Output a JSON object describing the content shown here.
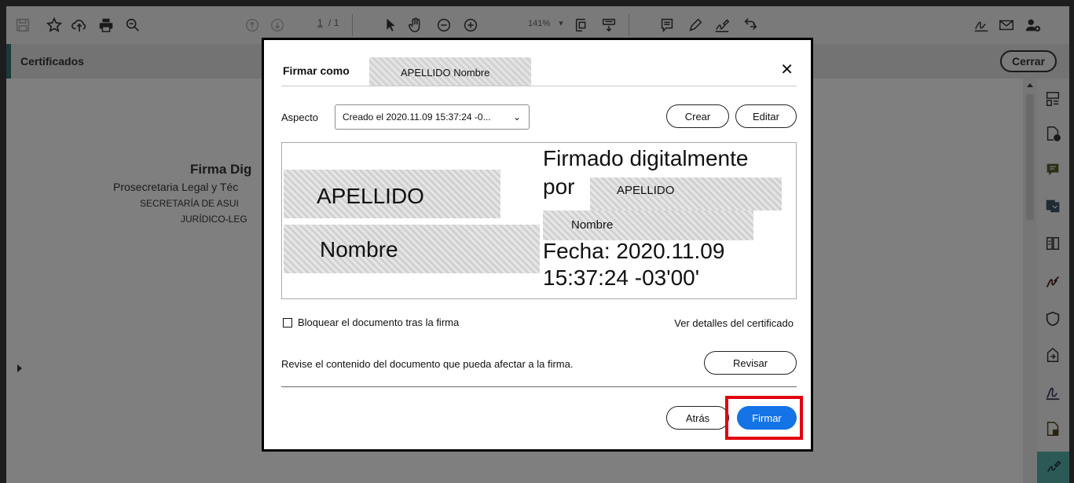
{
  "toolbar": {
    "page_current": "1",
    "page_sep": "/",
    "page_total": "1",
    "zoom": "141%",
    "icons": [
      "save-icon",
      "star-icon",
      "upload-icon",
      "print-icon",
      "zoom-search-icon",
      "page-up-icon",
      "page-down-icon",
      "pointer-icon",
      "hand-icon",
      "zoom-out-icon",
      "zoom-in-icon",
      "fit-page-icon",
      "scroll-mode-icon",
      "comment-icon",
      "pen-icon",
      "sign-icon",
      "export-icon",
      "sign-request-icon",
      "mail-icon",
      "add-user-icon"
    ]
  },
  "certbar": {
    "title": "Certificados",
    "close_label": "Cerrar"
  },
  "document": {
    "line1": "Firma Dig",
    "line2": "Prosecretaria Legal y Téc",
    "line3": "SECRETARÍA DE ASUI",
    "line4": "JURÍDICO-LEG"
  },
  "dialog": {
    "title": "Firmar como",
    "signer_name": "APELLIDO Nombre",
    "aspect_label": "Aspecto",
    "aspect_value": "Creado el 2020.11.09 15:37:24 -0...",
    "create_label": "Crear",
    "edit_label": "Editar",
    "preview": {
      "name_line1": "APELLIDO",
      "name_line2": "Nombre",
      "signed_line1": "Firmado digitalmente",
      "signed_por": "por",
      "signed_surname": "APELLIDO",
      "signed_name": "Nombre",
      "date_line1": "Fecha: 2020.11.09",
      "date_line2": "15:37:24 -03'00'"
    },
    "lock_label": "Bloquear el documento tras la firma",
    "lock_checked": false,
    "cert_details_label": "Ver detalles del certificado",
    "review_text": "Revise el contenido del documento que pueda afectar a la firma.",
    "review_label": "Revisar",
    "back_label": "Atrás",
    "sign_label": "Firmar"
  },
  "colors": {
    "primary_button": "#1473e6",
    "highlight": "#e3000f",
    "active_tool": "#2b5a56"
  }
}
